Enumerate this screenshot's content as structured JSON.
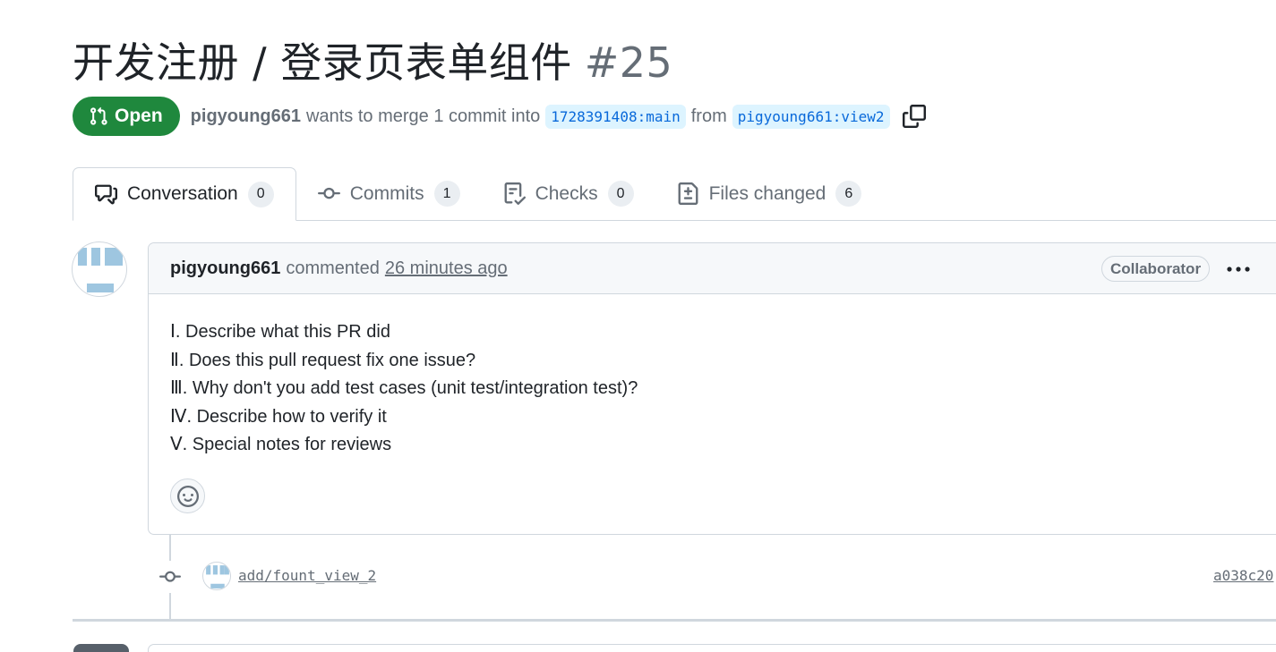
{
  "pr": {
    "title": "开发注册 / 登录页表单组件",
    "number": "#25",
    "state": "Open",
    "author": "pigyoung661",
    "merge_text": "wants to merge 1 commit into",
    "base_branch": "1728391408:main",
    "from_text": "from",
    "head_branch": "pigyoung661:view2"
  },
  "tabs": [
    {
      "label": "Conversation",
      "count": "0",
      "icon": "comment-discussion-icon"
    },
    {
      "label": "Commits",
      "count": "1",
      "icon": "git-commit-icon"
    },
    {
      "label": "Checks",
      "count": "0",
      "icon": "checklist-icon"
    },
    {
      "label": "Files changed",
      "count": "6",
      "icon": "file-diff-icon"
    }
  ],
  "comment": {
    "author": "pigyoung661",
    "action": "commented",
    "time": "26 minutes ago",
    "role": "Collaborator",
    "lines": [
      "Ⅰ. Describe what this PR did",
      "Ⅱ. Does this pull request fix one issue?",
      "Ⅲ. Why don't you add test cases (unit test/integration test)?",
      "Ⅳ. Describe how to verify it",
      "Ⅴ. Special notes for reviews"
    ]
  },
  "commit": {
    "message": "add/fount_view_2",
    "sha": "a038c20"
  },
  "colors": {
    "open_green": "#1f883d",
    "branch_bg": "#ddf4ff",
    "link_blue": "#0969da",
    "border": "#d0d7de",
    "muted": "#656d76"
  }
}
